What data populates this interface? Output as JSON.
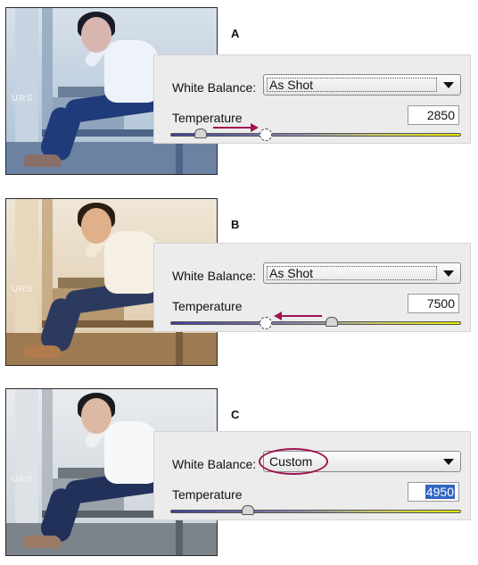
{
  "panels": [
    {
      "letter": "A",
      "white_balance_label": "White Balance:",
      "white_balance_value": "As Shot",
      "temperature_label": "Temperature",
      "temperature_value": "2850",
      "photo_tone": "cool"
    },
    {
      "letter": "B",
      "white_balance_label": "White Balance:",
      "white_balance_value": "As Shot",
      "temperature_label": "Temperature",
      "temperature_value": "7500",
      "photo_tone": "warm"
    },
    {
      "letter": "C",
      "white_balance_label": "White Balance:",
      "white_balance_value": "Custom",
      "temperature_label": "Temperature",
      "temperature_value": "4950",
      "photo_tone": "neutral"
    }
  ],
  "colors": {
    "annotation": "#a0144f",
    "selection": "#3166c2"
  },
  "icons": {
    "dropdown": "chevron-down-icon",
    "slider_handle": "slider-thumb-icon",
    "target_marker": "dashed-circle-icon",
    "direction_arrow": "arrow-icon"
  }
}
